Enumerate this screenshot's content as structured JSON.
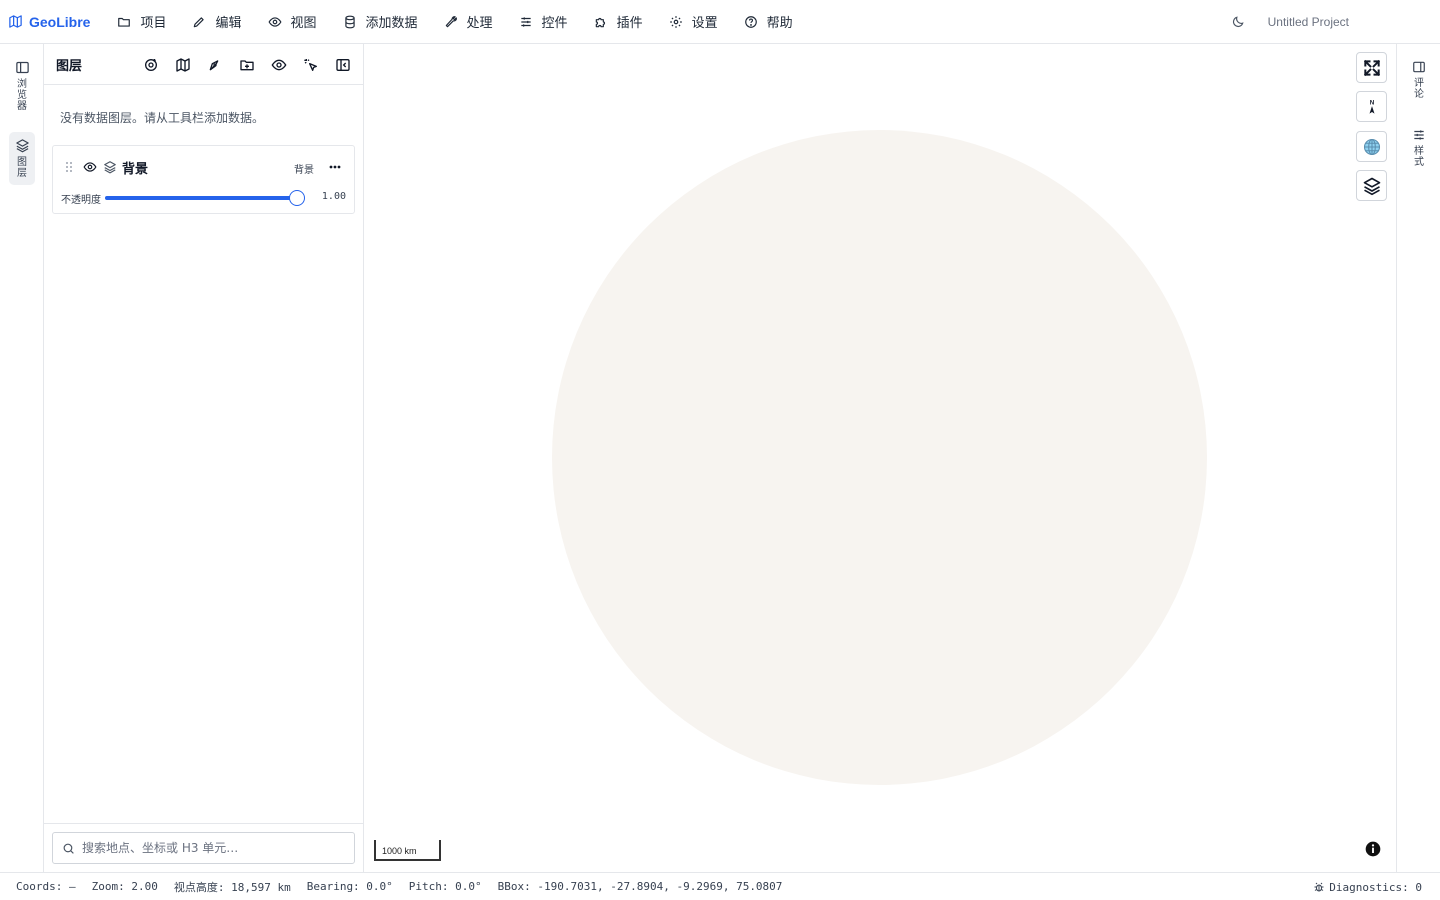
{
  "app": {
    "name": "GeoLibre",
    "project_name": "Untitled Project",
    "accent_color": "#2563eb"
  },
  "menu": [
    {
      "icon": "folder-icon",
      "label": "项目"
    },
    {
      "icon": "pencil-icon",
      "label": "编辑"
    },
    {
      "icon": "eye-icon",
      "label": "视图"
    },
    {
      "icon": "database-icon",
      "label": "添加数据"
    },
    {
      "icon": "wrench-icon",
      "label": "处理"
    },
    {
      "icon": "sliders-icon",
      "label": "控件"
    },
    {
      "icon": "puzzle-icon",
      "label": "插件"
    },
    {
      "icon": "gear-icon",
      "label": "设置"
    },
    {
      "icon": "help-circle-icon",
      "label": "帮助"
    }
  ],
  "left_rail": {
    "browser_label": "浏览器",
    "layers_label": "图层",
    "active": "layers"
  },
  "layers_panel": {
    "title": "图层",
    "tools": [
      "add-layer-icon",
      "map-icon",
      "draw-icon",
      "add-group-icon",
      "visibility-icon",
      "identify-icon",
      "collapse-panel-icon"
    ],
    "empty_message": "没有数据图层。请从工具栏添加数据。",
    "layers": [
      {
        "name": "背景",
        "tag": "背景",
        "visible": true,
        "opacity_label": "不透明度",
        "opacity": 1.0,
        "opacity_text": "1.00"
      }
    ]
  },
  "search": {
    "placeholder": "搜索地点、坐标或 H3 单元…",
    "value": ""
  },
  "map": {
    "globe_color": "#f7f4f0",
    "scale_label": "1000 km",
    "controls": [
      "fullscreen-icon",
      "compass-icon",
      "globe-icon",
      "layers-icon"
    ],
    "compass_label": "N"
  },
  "right_rail": {
    "comments_label": "评论",
    "style_label": "样式"
  },
  "status": {
    "coords": "Coords: —",
    "zoom": "Zoom: 2.00",
    "altitude": "视点高度: 18,597 km",
    "bearing": "Bearing: 0.0°",
    "pitch": "Pitch: 0.0°",
    "bbox": "BBox: -190.7031, -27.8904, -9.2969, 75.0807",
    "diagnostics": "Diagnostics: 0"
  }
}
